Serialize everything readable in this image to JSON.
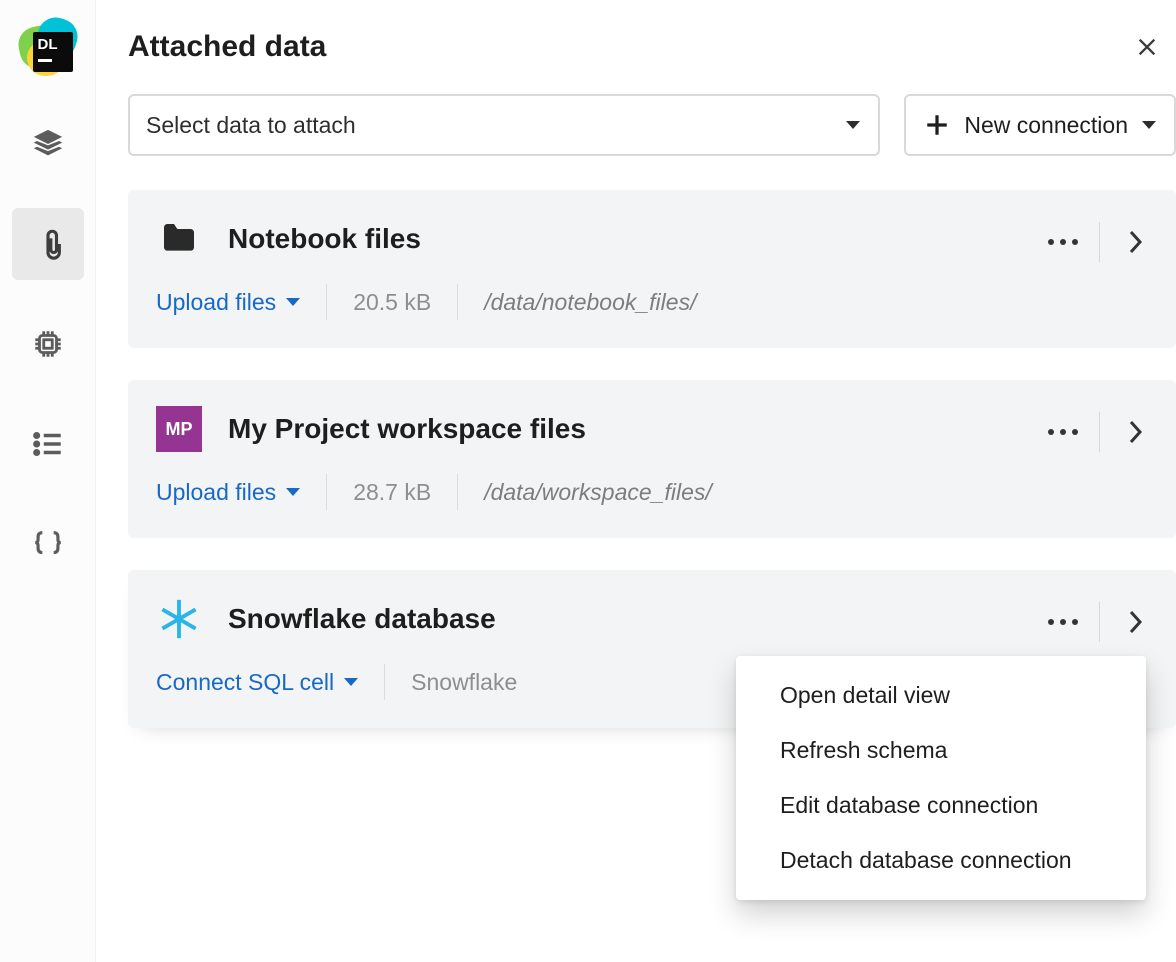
{
  "header": {
    "title": "Attached data"
  },
  "controls": {
    "select_placeholder": "Select data to attach",
    "new_connection_label": "New connection"
  },
  "cards": [
    {
      "title": "Notebook files",
      "action_label": "Upload files",
      "size": "20.5 kB",
      "path": "/data/notebook_files/"
    },
    {
      "badge": "MP",
      "title": "My Project workspace files",
      "action_label": "Upload files",
      "size": "28.7 kB",
      "path": "/data/workspace_files/"
    },
    {
      "title": "Snowflake database",
      "action_label": "Connect SQL cell",
      "detail": "Snowflake"
    }
  ],
  "context_menu": {
    "items": [
      "Open detail view",
      "Refresh schema",
      "Edit database connection",
      "Detach database connection"
    ]
  },
  "logo_text": "DL"
}
